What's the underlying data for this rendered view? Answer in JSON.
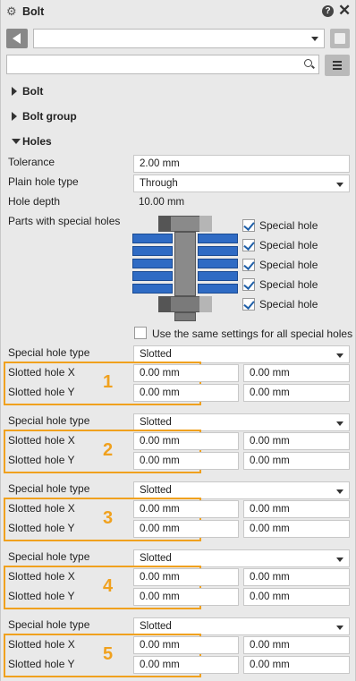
{
  "window": {
    "title": "Bolt"
  },
  "toolbar": {
    "preset_value": "",
    "search_placeholder": ""
  },
  "sections": {
    "bolt": "Bolt",
    "bolt_group": "Bolt group",
    "holes": "Holes"
  },
  "holes": {
    "tolerance_label": "Tolerance",
    "tolerance_value": "2.00 mm",
    "plain_hole_type_label": "Plain hole type",
    "plain_hole_type_value": "Through",
    "hole_depth_label": "Hole depth",
    "hole_depth_value": "10.00 mm",
    "parts_label": "Parts with special holes",
    "special_hole_label": "Special hole",
    "same_settings_label": "Use the same settings for all special holes"
  },
  "special_holes": [
    {
      "type_label": "Special hole type",
      "type_value": "Slotted",
      "x_label": "Slotted hole X",
      "y_label": "Slotted hole Y",
      "x1": "0.00 mm",
      "x2": "0.00 mm",
      "y1": "0.00 mm",
      "y2": "0.00 mm",
      "marker": "1"
    },
    {
      "type_label": "Special hole type",
      "type_value": "Slotted",
      "x_label": "Slotted hole X",
      "y_label": "Slotted hole Y",
      "x1": "0.00 mm",
      "x2": "0.00 mm",
      "y1": "0.00 mm",
      "y2": "0.00 mm",
      "marker": "2"
    },
    {
      "type_label": "Special hole type",
      "type_value": "Slotted",
      "x_label": "Slotted hole X",
      "y_label": "Slotted hole Y",
      "x1": "0.00 mm",
      "x2": "0.00 mm",
      "y1": "0.00 mm",
      "y2": "0.00 mm",
      "marker": "3"
    },
    {
      "type_label": "Special hole type",
      "type_value": "Slotted",
      "x_label": "Slotted hole X",
      "y_label": "Slotted hole Y",
      "x1": "0.00 mm",
      "x2": "0.00 mm",
      "y1": "0.00 mm",
      "y2": "0.00 mm",
      "marker": "4"
    },
    {
      "type_label": "Special hole type",
      "type_value": "Slotted",
      "x_label": "Slotted hole X",
      "y_label": "Slotted hole Y",
      "x1": "0.00 mm",
      "x2": "0.00 mm",
      "y1": "0.00 mm",
      "y2": "0.00 mm",
      "marker": "5"
    }
  ],
  "colors": {
    "accent_orange": "#f0a11e",
    "plate_blue": "#2f6bc4",
    "bolt_grey": "#7f7f7f"
  }
}
